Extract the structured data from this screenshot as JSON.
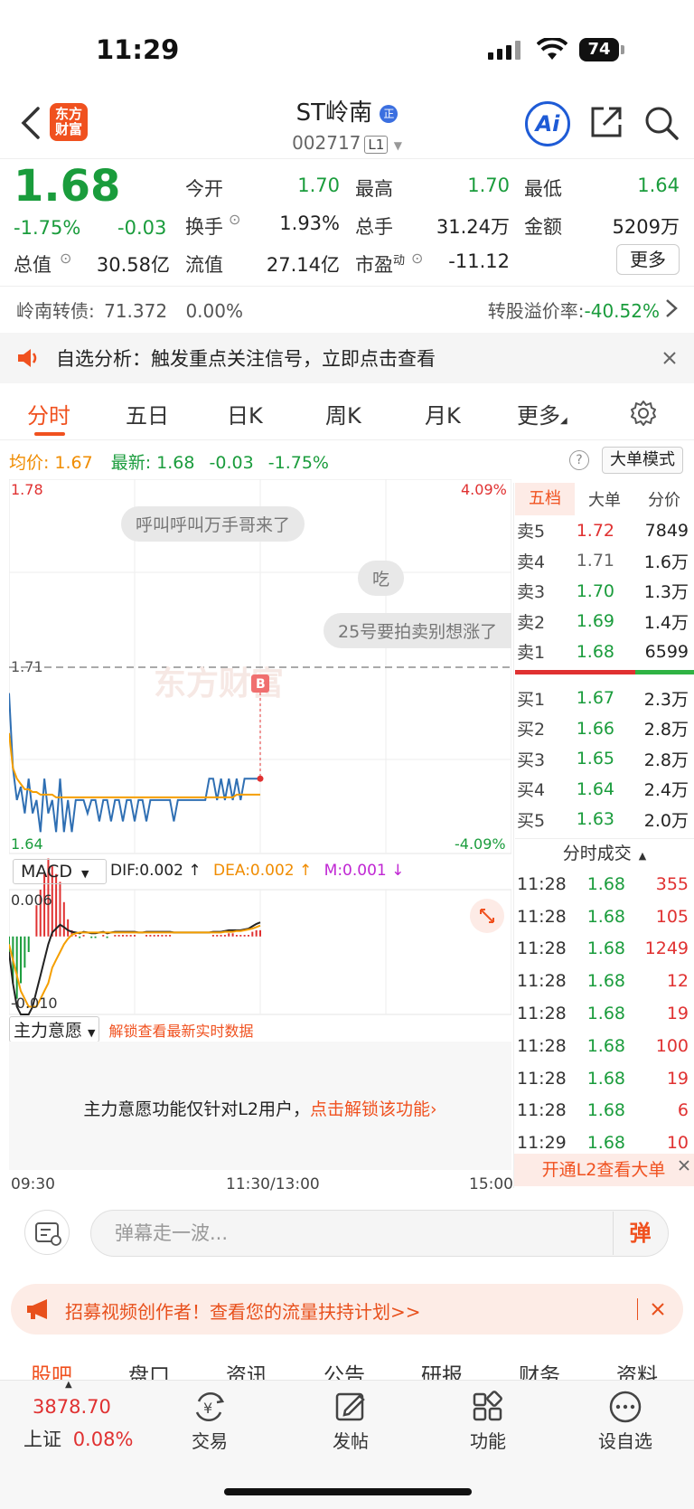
{
  "status": {
    "time": "11:29",
    "battery": "74"
  },
  "header": {
    "logo_text": "东方财富",
    "name": "ST岭南",
    "name_badge": "正",
    "code": "002717",
    "level": "L1",
    "ai_label": "Ai"
  },
  "quote": {
    "price": "1.68",
    "change_pct": "-1.75%",
    "change": "-0.03",
    "open_label": "今开",
    "open": "1.70",
    "high_label": "最高",
    "high": "1.70",
    "low_label": "最低",
    "low": "1.64",
    "turnover_label": "换手",
    "turnover": "1.93%",
    "volume_label": "总手",
    "volume": "31.24万",
    "amount_label": "金额",
    "amount": "5209万",
    "mcap_label": "总值",
    "mcap": "30.58亿",
    "float_label": "流值",
    "float": "27.14亿",
    "pe_label": "市盈",
    "pe_sup": "动",
    "pe": "-11.12",
    "more_label": "更多"
  },
  "bond": {
    "label": "岭南转债:",
    "price": "71.372",
    "pct": "0.00%",
    "premium_label": "转股溢价率:",
    "premium": "-40.52%"
  },
  "alert": {
    "text": "自选分析：触发重点关注信号，立即点击查看"
  },
  "tabs": [
    "分时",
    "五日",
    "日K",
    "周K",
    "月K",
    "更多"
  ],
  "avg_bar": {
    "avg_label": "均价:",
    "avg": "1.67",
    "latest_label": "最新:",
    "latest": "1.68",
    "change": "-0.03",
    "pct": "-1.75%",
    "mode_btn": "大单模式"
  },
  "chart_labels": {
    "top_price": "1.78",
    "top_pct": "4.09%",
    "bottom_price": "1.64",
    "bottom_pct": "-4.09%",
    "ref_price": "1.71",
    "watermark": "东方财富",
    "b_marker": "B"
  },
  "barrage": [
    "呼叫呼叫万手哥来了",
    "吃",
    "25号要拍卖别想涨了"
  ],
  "chart_data": {
    "type": "line",
    "yrange": [
      1.64,
      1.78
    ],
    "ref": 1.71,
    "price": [
      1.7,
      1.672,
      1.66,
      1.665,
      1.655,
      1.668,
      1.655,
      1.66,
      1.648,
      1.668,
      1.655,
      1.66,
      1.648,
      1.668,
      1.648,
      1.66,
      1.648,
      1.66,
      1.66,
      1.66,
      1.655,
      1.66,
      1.66,
      1.652,
      1.66,
      1.66,
      1.652,
      1.66,
      1.66,
      1.652,
      1.66,
      1.66,
      1.652,
      1.66,
      1.66,
      1.652,
      1.66,
      1.66,
      1.66,
      1.66,
      1.66,
      1.66,
      1.652,
      1.66,
      1.66,
      1.66,
      1.66,
      1.66,
      1.66,
      1.66,
      1.66,
      1.668,
      1.668,
      1.66,
      1.668,
      1.66,
      1.668,
      1.66,
      1.668,
      1.66,
      1.668,
      1.668,
      1.668,
      1.668,
      1.668
    ],
    "avg": [
      1.685,
      1.672,
      1.668,
      1.666,
      1.664,
      1.664,
      1.663,
      1.663,
      1.662,
      1.662,
      1.662,
      1.662,
      1.661,
      1.661,
      1.661,
      1.661,
      1.661,
      1.661,
      1.661,
      1.661,
      1.661,
      1.661,
      1.661,
      1.661,
      1.661,
      1.661,
      1.661,
      1.661,
      1.661,
      1.661,
      1.661,
      1.661,
      1.661,
      1.661,
      1.661,
      1.661,
      1.661,
      1.661,
      1.661,
      1.661,
      1.661,
      1.661,
      1.661,
      1.661,
      1.661,
      1.661,
      1.661,
      1.661,
      1.661,
      1.661,
      1.661,
      1.661,
      1.661,
      1.661,
      1.661,
      1.661,
      1.661,
      1.661,
      1.662,
      1.662,
      1.662,
      1.662,
      1.662,
      1.662,
      1.662
    ],
    "macd_yrange": [
      -0.01,
      0.006
    ],
    "dif": [
      -0.002,
      -0.006,
      -0.009,
      -0.01,
      -0.01,
      -0.01,
      -0.009,
      -0.007,
      -0.005,
      -0.003,
      -0.001,
      0.0005,
      0.001,
      0.0015,
      0.0012,
      0.0008,
      0.0006,
      0.0005,
      0.0004,
      0.0006,
      0.0005,
      0.0004,
      0.0004,
      0.0005,
      0.0006,
      0.0004,
      0.0005,
      0.0006,
      0.0006,
      0.0006,
      0.0006,
      0.0006,
      0.0006,
      0.0005,
      0.0005,
      0.0006,
      0.0006,
      0.0006,
      0.0006,
      0.0006,
      0.0006,
      0.0006,
      0.0005,
      0.0005,
      0.0005,
      0.0005,
      0.0005,
      0.0005,
      0.0005,
      0.0005,
      0.0005,
      0.0005,
      0.0006,
      0.0006,
      0.0006,
      0.0007,
      0.0008,
      0.0008,
      0.0008,
      0.0008,
      0.0009,
      0.001,
      0.0013,
      0.0016,
      0.0018
    ],
    "dea": [
      -0.001,
      -0.003,
      -0.005,
      -0.007,
      -0.008,
      -0.009,
      -0.009,
      -0.009,
      -0.008,
      -0.007,
      -0.006,
      -0.004,
      -0.003,
      -0.002,
      -0.001,
      -0.0003,
      0.0002,
      0.0004,
      0.0005,
      0.0005,
      0.0005,
      0.0005,
      0.0005,
      0.0005,
      0.0005,
      0.0005,
      0.0005,
      0.0005,
      0.0005,
      0.0005,
      0.0005,
      0.0005,
      0.0005,
      0.0005,
      0.0005,
      0.0005,
      0.0005,
      0.0005,
      0.0005,
      0.0005,
      0.0005,
      0.0005,
      0.0005,
      0.0005,
      0.0005,
      0.0005,
      0.0005,
      0.0005,
      0.0005,
      0.0005,
      0.0005,
      0.0005,
      0.0005,
      0.0005,
      0.0005,
      0.0006,
      0.0006,
      0.0006,
      0.0007,
      0.0007,
      0.0008,
      0.0009,
      0.001,
      0.0012,
      0.0014
    ],
    "axis_times": [
      "09:30",
      "11:30/13:00",
      "15:00"
    ]
  },
  "macd": {
    "selector": "MACD",
    "dif": "DIF:0.002",
    "dea": "DEA:0.002",
    "m": "M:0.001",
    "top": "0.006",
    "bottom": "-0.010"
  },
  "book": {
    "tabs": [
      "五档",
      "大单",
      "分价"
    ],
    "asks": [
      {
        "label": "卖5",
        "price": "1.72",
        "vol": "7849",
        "color": "red"
      },
      {
        "label": "卖4",
        "price": "1.71",
        "vol": "1.6万",
        "color": "gray"
      },
      {
        "label": "卖3",
        "price": "1.70",
        "vol": "1.3万",
        "color": "green"
      },
      {
        "label": "卖2",
        "price": "1.69",
        "vol": "1.4万",
        "color": "green"
      },
      {
        "label": "卖1",
        "price": "1.68",
        "vol": "6599",
        "color": "green"
      }
    ],
    "bids": [
      {
        "label": "买1",
        "price": "1.67",
        "vol": "2.3万"
      },
      {
        "label": "买2",
        "price": "1.66",
        "vol": "2.8万"
      },
      {
        "label": "买3",
        "price": "1.65",
        "vol": "2.8万"
      },
      {
        "label": "买4",
        "price": "1.64",
        "vol": "2.4万"
      },
      {
        "label": "买5",
        "price": "1.63",
        "vol": "2.0万"
      }
    ],
    "trades_title": "分时成交",
    "trades": [
      {
        "t": "11:28",
        "p": "1.68",
        "v": "355",
        "c": "red"
      },
      {
        "t": "11:28",
        "p": "1.68",
        "v": "105",
        "c": "red"
      },
      {
        "t": "11:28",
        "p": "1.68",
        "v": "1249",
        "c": "red"
      },
      {
        "t": "11:28",
        "p": "1.68",
        "v": "12",
        "c": "red"
      },
      {
        "t": "11:28",
        "p": "1.68",
        "v": "19",
        "c": "red"
      },
      {
        "t": "11:28",
        "p": "1.68",
        "v": "100",
        "c": "red"
      },
      {
        "t": "11:28",
        "p": "1.68",
        "v": "19",
        "c": "red"
      },
      {
        "t": "11:28",
        "p": "1.68",
        "v": "6",
        "c": "red"
      },
      {
        "t": "11:29",
        "p": "1.68",
        "v": "10",
        "c": "red"
      }
    ],
    "l2_open": "开通L2查看大单"
  },
  "main_force": {
    "selector": "主力意愿",
    "unlock_hint": "解锁查看最新实时数据",
    "text": "主力意愿功能仅针对L2用户，",
    "link": "点击解锁该功能"
  },
  "danmu": {
    "placeholder": "弹幕走一波...",
    "send": "弹"
  },
  "promo": {
    "text": "招募视频创作者！查看您的流量扶持计划>>"
  },
  "sub_tabs": [
    "股吧",
    "盘口",
    "资讯",
    "公告",
    "研报",
    "财务",
    "资料"
  ],
  "bottom_nav": {
    "index_value": "3878.70",
    "index_name": "上证",
    "index_pct": "0.08%",
    "items": [
      "交易",
      "发帖",
      "功能",
      "设自选"
    ]
  }
}
